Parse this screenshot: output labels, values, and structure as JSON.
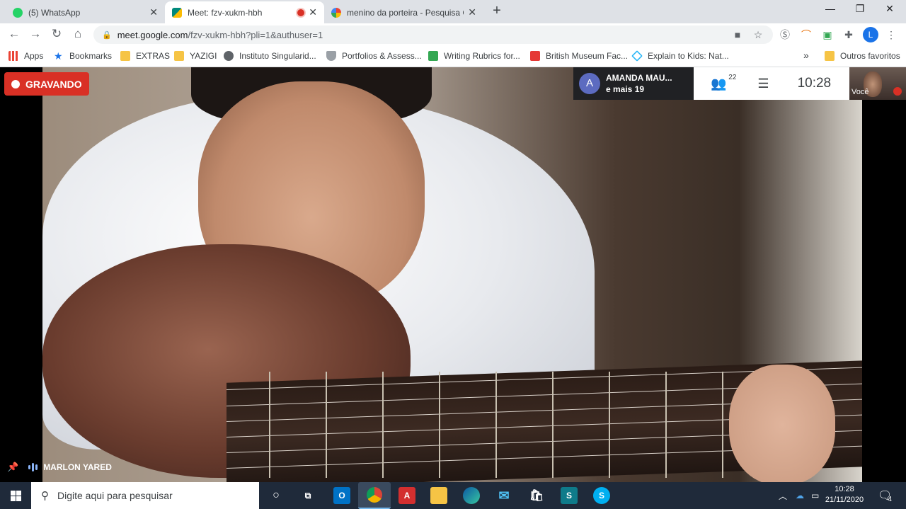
{
  "browser": {
    "tabs": [
      {
        "title": "(5) WhatsApp",
        "favicon": "whatsapp-icon",
        "color": "#25d366"
      },
      {
        "title": "Meet: fzv-xukm-hbh",
        "favicon": "google-meet-icon",
        "color": "#00897b",
        "active": true
      },
      {
        "title": "menino da porteira - Pesquisa Go",
        "favicon": "google-icon",
        "color": "#4285f4"
      }
    ],
    "url_domain": "meet.google.com",
    "url_path": "/fzv-xukm-hbh?pli=1&authuser=1",
    "profile_initial": "L",
    "bookmarks": [
      {
        "label": "Apps",
        "icon": "apps-grid-icon"
      },
      {
        "label": "Bookmarks",
        "icon": "star-icon"
      },
      {
        "label": "EXTRAS",
        "icon": "folder-icon"
      },
      {
        "label": "YAZIGI",
        "icon": "folder-icon"
      },
      {
        "label": "Instituto Singularid...",
        "icon": "globe-icon"
      },
      {
        "label": "Portfolios & Assess...",
        "icon": "shield-icon"
      },
      {
        "label": "Writing Rubrics for...",
        "icon": "rubric-icon"
      },
      {
        "label": "British Museum Fac...",
        "icon": "museum-icon"
      },
      {
        "label": "Explain to Kids: Nat...",
        "icon": "diamond-icon"
      }
    ],
    "overflow": "»",
    "other_bookmarks": "Outros favoritos"
  },
  "meet": {
    "recording_label": "GRAVANDO",
    "participant_avatar": "A",
    "participant_name": "AMANDA MAU...",
    "participant_more": "e mais 19",
    "people_count": "22",
    "time": "10:28",
    "self_label": "Você",
    "speaker_name": "MARLON YARED"
  },
  "taskbar": {
    "search_placeholder": "Digite aqui para pesquisar",
    "clock_time": "10:28",
    "clock_date": "21/11/2020",
    "notification_count": "4"
  }
}
